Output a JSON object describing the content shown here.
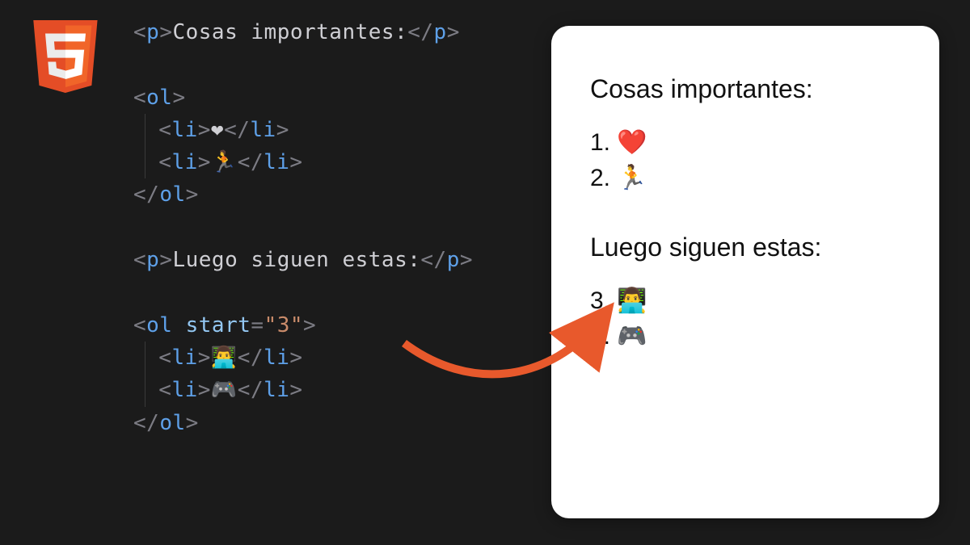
{
  "code": {
    "p1_text": "Cosas importantes:",
    "li1": "❤",
    "li2": "🏃",
    "p2_text": "Luego siguen estas:",
    "ol2_attr_name": "start",
    "ol2_attr_value": "\"3\"",
    "li3": "👨‍💻",
    "li4": "🎮",
    "tag_p": "p",
    "tag_ol": "ol",
    "tag_li": "li",
    "lt": "<",
    "gt": ">",
    "lts": "</",
    "eq": "=",
    "sp": " "
  },
  "preview": {
    "title1": "Cosas importantes:",
    "list1": {
      "items": [
        "❤️",
        "🏃"
      ]
    },
    "title2": "Luego siguen estas:",
    "list2": {
      "start": 3,
      "items": [
        "👨‍💻",
        "🎮"
      ]
    }
  }
}
